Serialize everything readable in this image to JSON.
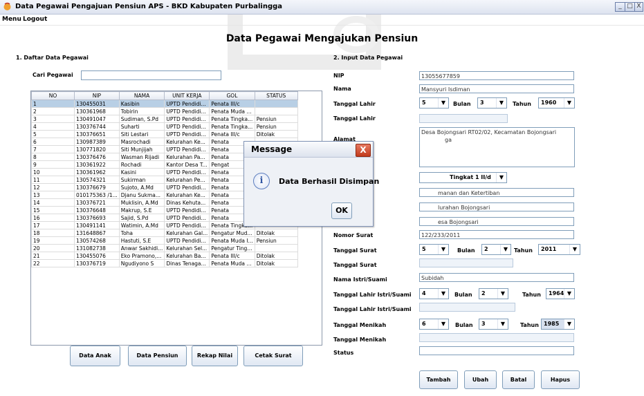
{
  "window": {
    "title": "Data Pegawai Pengajuan Pensiun APS - BKD Kabupaten Purbalingga",
    "minimize": "_",
    "maximize": "□",
    "close": "X"
  },
  "menu": [
    "Menu",
    "Logout"
  ],
  "heading": "Data Pegawai Mengajukan Pensiun",
  "list": {
    "section": "1. Daftar Data Pegawai",
    "search_label": "Cari Pegawai",
    "search_value": "",
    "columns": [
      "NO",
      "NIP",
      "NAMA",
      "UNIT KERJA",
      "GOL",
      "STATUS"
    ],
    "rows": [
      [
        "1",
        "130455031",
        "Kasibin",
        "UPTD Pendidi...",
        "Penata III/c",
        ""
      ],
      [
        "2",
        "130361968",
        "Tobirin",
        "UPTD Pendidi...",
        "Penata Muda ...",
        ""
      ],
      [
        "3",
        "130491047",
        "Sudiman, S.Pd",
        "UPTD Pendidi...",
        "Penata Tingka...",
        "Pensiun"
      ],
      [
        "4",
        "130376744",
        "Suharti",
        "UPTD Pendidi...",
        "Penata Tingka...",
        "Pensiun"
      ],
      [
        "5",
        "130376651",
        "Siti Lestari",
        "UPTD Pendidi...",
        "Penata III/c",
        "Ditolak"
      ],
      [
        "6",
        "130987389",
        "Masrochadi",
        "Kelurahan Ke...",
        "Penata",
        ""
      ],
      [
        "7",
        "130771820",
        "Siti Munjijah",
        "UPTD Pendidi...",
        "Penata",
        ""
      ],
      [
        "8",
        "130376476",
        "Wasman Rijadi",
        "Kelurahan Pa...",
        "Penata",
        ""
      ],
      [
        "9",
        "130361922",
        "Rochadi",
        "Kantor Desa T...",
        "Pengat",
        ""
      ],
      [
        "10",
        "130361962",
        "Kasini",
        "UPTD Pendidi...",
        "Penata",
        ""
      ],
      [
        "11",
        "130574321",
        "Sukirman",
        "Kelurahan Pe...",
        "Penata",
        ""
      ],
      [
        "12",
        "130376679",
        "Sujoto, A.Md",
        "UPTD Pendidi...",
        "Penata",
        ""
      ],
      [
        "13",
        "010175363 /1...",
        "Djanu Sukma...",
        "Kelurahan Ke...",
        "Penata",
        ""
      ],
      [
        "14",
        "130376721",
        "Muklisin, A.Md",
        "Dinas Kehuta...",
        "Penata",
        ""
      ],
      [
        "15",
        "130376648",
        "Makrup, S.E",
        "UPTD Pendidi...",
        "Penata",
        ""
      ],
      [
        "16",
        "130376693",
        "Sajid, S.Pd",
        "UPTD Pendidi...",
        "Penata",
        ""
      ],
      [
        "17",
        "130491141",
        "Watimin, A.Md",
        "UPTD Pendidi...",
        "Penata Tingka...",
        ""
      ],
      [
        "18",
        "131648867",
        "Toha",
        "Kelurahan Gal...",
        "Pengatur Mud...",
        "Ditolak"
      ],
      [
        "19",
        "130574268",
        "Hastuti, S.E",
        "UPTD Pendidi...",
        "Penata Muda I...",
        "Pensiun"
      ],
      [
        "20",
        "131082738",
        "Anwar Sakhidi...",
        "Kelurahan Sel...",
        "Pengatur Ting...",
        ""
      ],
      [
        "21",
        "130455076",
        "Eko Pramono,...",
        "Kelurahan Ba...",
        "Penata III/c",
        "Ditolak"
      ],
      [
        "22",
        "130376719",
        "Ngudiyono S",
        "Dinas Tenaga...",
        "Penata Muda ...",
        "Ditolak"
      ]
    ],
    "selected_row": 0,
    "buttons": [
      "Data Anak",
      "Data Pensiun",
      "Rekap Nilai",
      "Cetak Surat"
    ]
  },
  "form": {
    "section": "2. Input Data Pegawai",
    "nip_label": "NIP",
    "nip_value": "13055677859",
    "nama_label": "Nama",
    "nama_value": "Mansyuri Isdiman",
    "tgl_lahir_label": "Tanggal Lahir",
    "tgl_lahir_day": "5",
    "tgl_lahir_month": "3",
    "tgl_lahir_year": "1960",
    "tgl_lahir2_label": "Tanggal Lahir",
    "alamat_label": "Alamat",
    "alamat_line1": "Desa Bojongsari RT02/02, Kecamatan Bojongsari",
    "alamat_line2": "ga",
    "gol_value": "Tingkat 1 II/d",
    "jabatan_value": "manan dan Ketertiban",
    "unit_value": "lurahan Bojongsari",
    "instansi_value": "esa Bojongsari",
    "nomor_surat_label": "Nomor Surat",
    "nomor_surat_value": "122/233/2011",
    "tgl_surat_label": "Tanggal Surat",
    "tgl_surat_day": "5",
    "tgl_surat_month": "2",
    "tgl_surat_year": "2011",
    "tgl_surat2_label": "Tanggal Surat",
    "istri_label": "Nama Istri/Suami",
    "istri_value": "Subidah",
    "tgl_istri_label": "Tanggal Lahir Istri/Suami",
    "tgl_istri_day": "4",
    "tgl_istri_month": "2",
    "tgl_istri_year": "1964",
    "tgl_istri2_label": "Tanggal Lahir Istri/Suami",
    "tgl_nikah_label": "Tanggal Menikah",
    "tgl_nikah_day": "6",
    "tgl_nikah_month": "3",
    "tgl_nikah_year": "1985",
    "tgl_nikah2_label": "Tanggal Menikah",
    "status_label": "Status",
    "bulan_label": "Bulan",
    "tahun_label": "Tahun",
    "buttons": [
      "Tambah",
      "Ubah",
      "Batal",
      "Hapus"
    ]
  },
  "dialog": {
    "title": "Message",
    "message": "Data Berhasil Disimpan",
    "ok": "OK",
    "close": "X",
    "icon": "i"
  },
  "icons": {
    "dropdown": "▼"
  },
  "colors": {
    "selection": "#b8cfe5",
    "close_button": "#c13a1c",
    "border": "#7f9db9"
  }
}
